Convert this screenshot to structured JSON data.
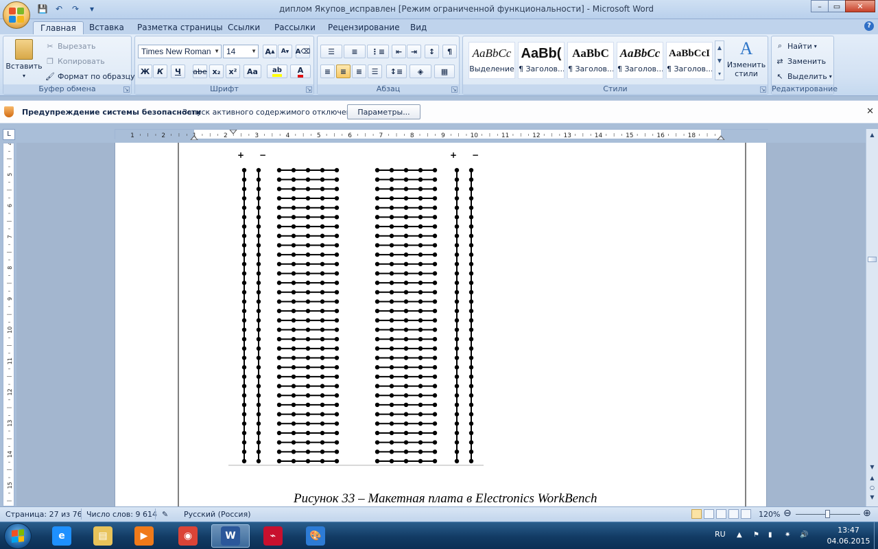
{
  "window": {
    "title": "диплом Якупов_исправлен [Режим ограниченной функциональности]  -  Microsoft Word",
    "controls": {
      "minimize": "–",
      "maximize": "▭",
      "close": "✕"
    }
  },
  "tabs": [
    "Главная",
    "Вставка",
    "Разметка страницы",
    "Ссылки",
    "Рассылки",
    "Рецензирование",
    "Вид"
  ],
  "ribbon": {
    "clipboard": {
      "group": "Буфер обмена",
      "paste": "Вставить",
      "cut": "Вырезать",
      "copy": "Копировать",
      "format_painter": "Формат по образцу"
    },
    "font": {
      "group": "Шрифт",
      "family": "Times New Roman",
      "size": "14",
      "bold": "Ж",
      "italic": "К",
      "underline": "Ч",
      "strike": "abe",
      "subscript": "x₂",
      "superscript": "x²",
      "case": "Aa",
      "grow": "A",
      "shrink": "A"
    },
    "paragraph": {
      "group": "Абзац"
    },
    "styles": {
      "group": "Стили",
      "items": [
        {
          "sample": "AaBbCc",
          "name": "Выделение"
        },
        {
          "sample": "AaBb(",
          "name": "¶ Заголов..."
        },
        {
          "sample": "AaBbC",
          "name": "¶ Заголов..."
        },
        {
          "sample": "AaBbCc",
          "name": "¶ Заголов..."
        },
        {
          "sample": "AaBbCcI",
          "name": "¶ Заголов..."
        }
      ],
      "change": "Изменить стили"
    },
    "editing": {
      "group": "Редактирование",
      "find": "Найти",
      "replace": "Заменить",
      "select": "Выделить"
    }
  },
  "security": {
    "title": "Предупреждение системы безопасности",
    "message": "Запуск активного содержимого отключен.",
    "button": "Параметры..."
  },
  "ruler": {
    "corner": "L",
    "h_numbers": [
      "1",
      "2",
      "1",
      "2",
      "3",
      "4",
      "5",
      "6",
      "7",
      "8",
      "9",
      "10",
      "11",
      "12",
      "13",
      "14",
      "15",
      "16",
      "18"
    ],
    "v_numbers": [
      "4",
      "5",
      "6",
      "7",
      "8",
      "9",
      "10",
      "11",
      "12",
      "13",
      "14",
      "15"
    ]
  },
  "document": {
    "board": {
      "plus": "+",
      "minus": "−",
      "rows": 32
    },
    "caption": "Рисунок 33 – Макетная плата в Electronics WorkBench"
  },
  "status": {
    "page": "Страница: 27 из 76",
    "words": "Число слов: 9 614",
    "language": "Русский (Россия)",
    "zoom": "120%",
    "zoom_level": 0.5
  },
  "taskbar": {
    "apps": [
      {
        "name": "internet-explorer",
        "color": "#1e90ff",
        "glyph": "e"
      },
      {
        "name": "explorer",
        "color": "#e8c35a",
        "glyph": "▤"
      },
      {
        "name": "media-player",
        "color": "#f07a1a",
        "glyph": "▶"
      },
      {
        "name": "chrome",
        "color": "#db4437",
        "glyph": "◉"
      },
      {
        "name": "word",
        "color": "#2b579a",
        "glyph": "W"
      },
      {
        "name": "electronics-workbench",
        "color": "#c8102e",
        "glyph": "⌁"
      },
      {
        "name": "paint",
        "color": "#2d7bd5",
        "glyph": "🎨"
      }
    ],
    "lang": "RU",
    "time": "13:47",
    "date": "04.06.2015"
  }
}
